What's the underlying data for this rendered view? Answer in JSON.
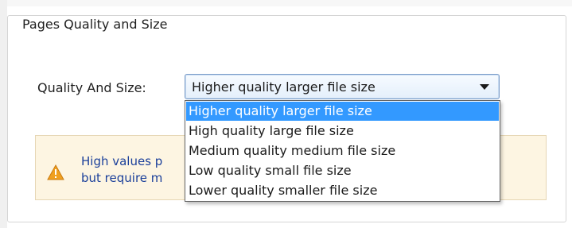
{
  "group": {
    "title": "Pages Quality and Size"
  },
  "quality": {
    "label": "Quality And Size:",
    "selected": "Higher quality larger file size",
    "options": [
      "Higher quality larger file size",
      "High quality large file size",
      "Medium quality medium file size",
      "Low quality small file size",
      "Lower quality smaller file size"
    ],
    "highlighted_index": 0
  },
  "warning": {
    "icon": "warning-icon",
    "line1_visible": "High values p",
    "line2_visible": "but require m"
  },
  "colors": {
    "selection": "#3399ff",
    "warning_bg": "#fdf5e2",
    "warning_text": "#1a3f9a",
    "warning_icon": "#f0a020"
  }
}
